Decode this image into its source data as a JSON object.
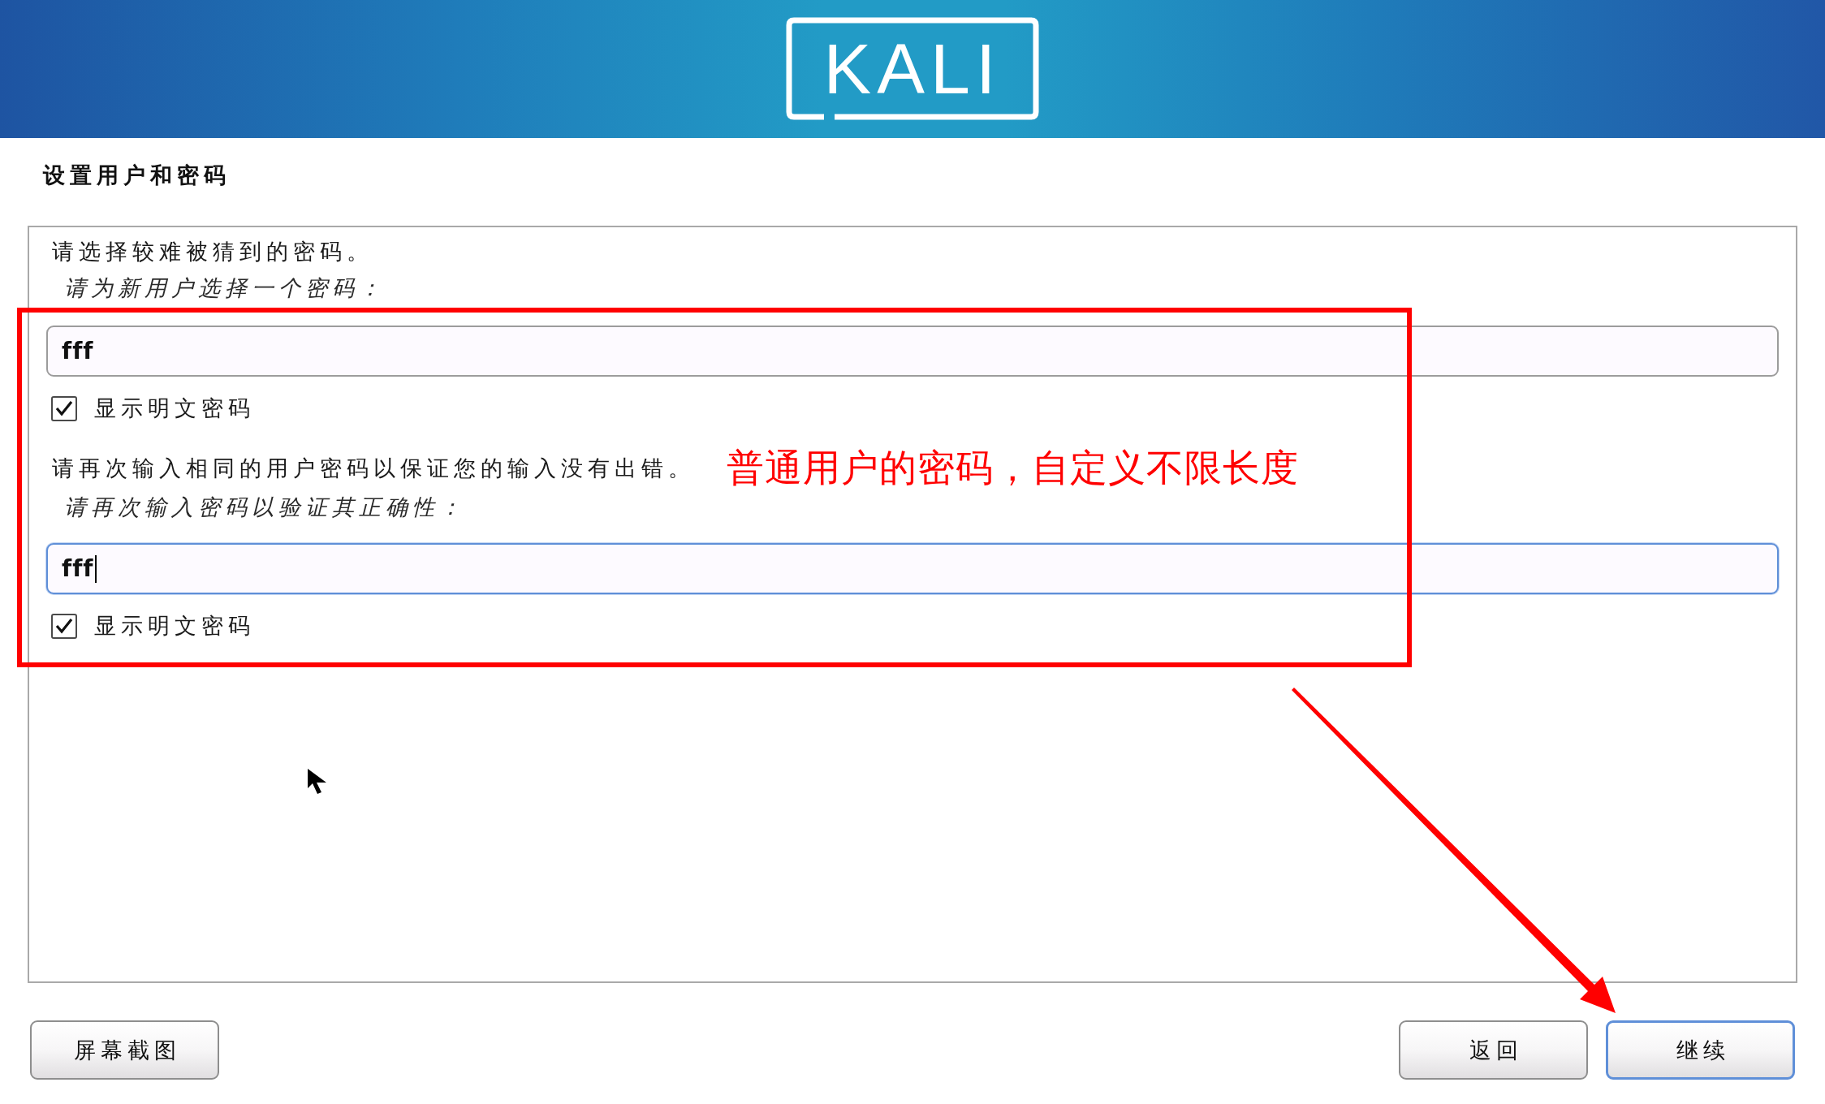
{
  "header": {
    "logo": "KALI"
  },
  "page": {
    "title": "设置用户和密码"
  },
  "sections": [
    {
      "intro": "请选择较难被猜到的密码。",
      "prompt": "请为新用户选择一个密码：",
      "field": {
        "value": "fff",
        "focused": false
      },
      "show_password": {
        "label": "显示明文密码",
        "checked": true
      }
    },
    {
      "intro": "请再次输入相同的用户密码以保证您的输入没有出错。",
      "prompt": "请再次输入密码以验证其正确性：",
      "field": {
        "value": "fff",
        "focused": true
      },
      "show_password": {
        "label": "显示明文密码",
        "checked": true
      }
    }
  ],
  "footer": {
    "left_buttons": [
      {
        "label": "屏幕截图",
        "focused": false
      }
    ],
    "right_buttons": [
      {
        "label": "返回",
        "focused": false
      },
      {
        "label": "继续",
        "focused": true
      }
    ]
  },
  "annotation": {
    "text": "普通用户的密码，自定义不限长度"
  }
}
